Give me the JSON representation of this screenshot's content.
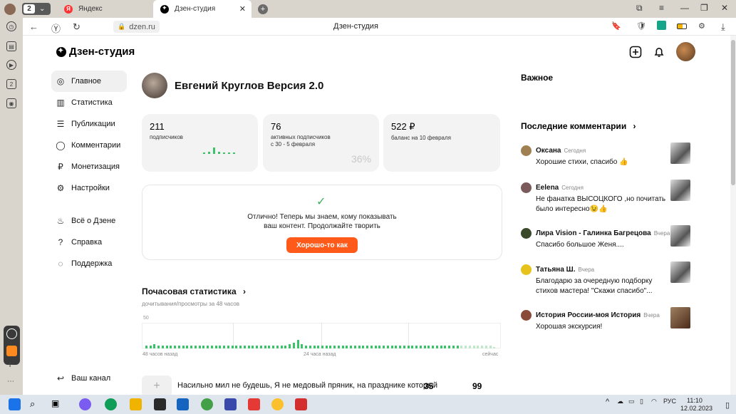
{
  "browser": {
    "tab_count": "2",
    "tabs": [
      {
        "label": "Яндекс"
      },
      {
        "label": "Дзен-студия"
      }
    ],
    "url": "dzen.ru",
    "page_title": "Дзен-студия"
  },
  "dzen": {
    "brand": "Дзен-студия",
    "nav": [
      {
        "label": "Главное",
        "icon": "planet-icon"
      },
      {
        "label": "Статистика",
        "icon": "stats-icon"
      },
      {
        "label": "Публикации",
        "icon": "stack-icon"
      },
      {
        "label": "Комментарии",
        "icon": "comment-icon"
      },
      {
        "label": "Монетизация",
        "icon": "ruble-icon"
      },
      {
        "label": "Настройки",
        "icon": "gear-icon"
      }
    ],
    "nav2": [
      {
        "label": "Всё о Дзене",
        "icon": "flame-icon"
      },
      {
        "label": "Справка",
        "icon": "question-icon"
      },
      {
        "label": "Поддержка",
        "icon": "chat-icon"
      }
    ],
    "own_channel": "Ваш канал",
    "profile_name": "Евгений Круглов Версия 2.0",
    "stats": {
      "subscribers": "211",
      "subscribers_label": "подписчиков",
      "active": "76",
      "active_label": "активных подписчиков",
      "active_period": "с 30 - 5 февраля",
      "active_percent": "36%",
      "balance": "522 ₽",
      "balance_label": "баланс на 10 февраля"
    },
    "success": {
      "line1": "Отлично! Теперь мы знаем, кому показывать",
      "line2": "ваш контент. Продолжайте творить",
      "button": "Хорошо-то как"
    },
    "hourly": {
      "title": "Почасовая статистика",
      "subtitle": "дочитывания/просмотры за 48 часов",
      "y_max_label": "50",
      "x_labels": [
        "48 часов назад",
        "24 часа назад",
        "сейчас"
      ]
    },
    "publication": {
      "text": "Насильно мил не будешь, Я не медовый пряник, на празднике который",
      "n1": "35",
      "n2": "99"
    },
    "right": {
      "important": "Важное",
      "comments_title": "Последние комментарии",
      "comments": [
        {
          "name": "Оксана",
          "date": "Сегодня",
          "text": "Хорошие стихи, спасибо 👍"
        },
        {
          "name": "Eelena",
          "date": "Сегодня",
          "text": "Не фанатка ВЫСОЦКОГО ,но почитать было интересно😉👍"
        },
        {
          "name": "Лира Vision - Галинка Багрецова",
          "date": "Вчера",
          "text": "Спасибо большое Женя...."
        },
        {
          "name": "Татьяна Ш.",
          "date": "Вчера",
          "text": "Благодарю за очередную подборку стихов мастера! \"Скажи спасибо\"..."
        },
        {
          "name": "История России-моя История",
          "date": "Вчера",
          "text": "Хорошая экскурсия!"
        }
      ]
    }
  },
  "taskbar": {
    "lang": "РУС",
    "time": "11:10",
    "date": "12.02.2023"
  },
  "chart_data": {
    "type": "bar",
    "ylim": [
      0,
      50
    ],
    "values": [
      2,
      2,
      3,
      2,
      2,
      2,
      2,
      2,
      2,
      2,
      2,
      2,
      2,
      2,
      2,
      2,
      2,
      2,
      2,
      2,
      2,
      2,
      2,
      2,
      2,
      2,
      2,
      2,
      2,
      2,
      2,
      2,
      2,
      2,
      2,
      3,
      4,
      6,
      3,
      2,
      2,
      2,
      2,
      2,
      2,
      2,
      2,
      2,
      2,
      2,
      2,
      2,
      2,
      2,
      2,
      2,
      2,
      2,
      2,
      2,
      2,
      2,
      2,
      2,
      2,
      2,
      2,
      2,
      2,
      2,
      2,
      2,
      2,
      2,
      2,
      2,
      2,
      2,
      2,
      2,
      2,
      2,
      2,
      2,
      2,
      1
    ]
  },
  "colors": {
    "accent": "#ff5a1a",
    "green": "#3cc36a"
  }
}
